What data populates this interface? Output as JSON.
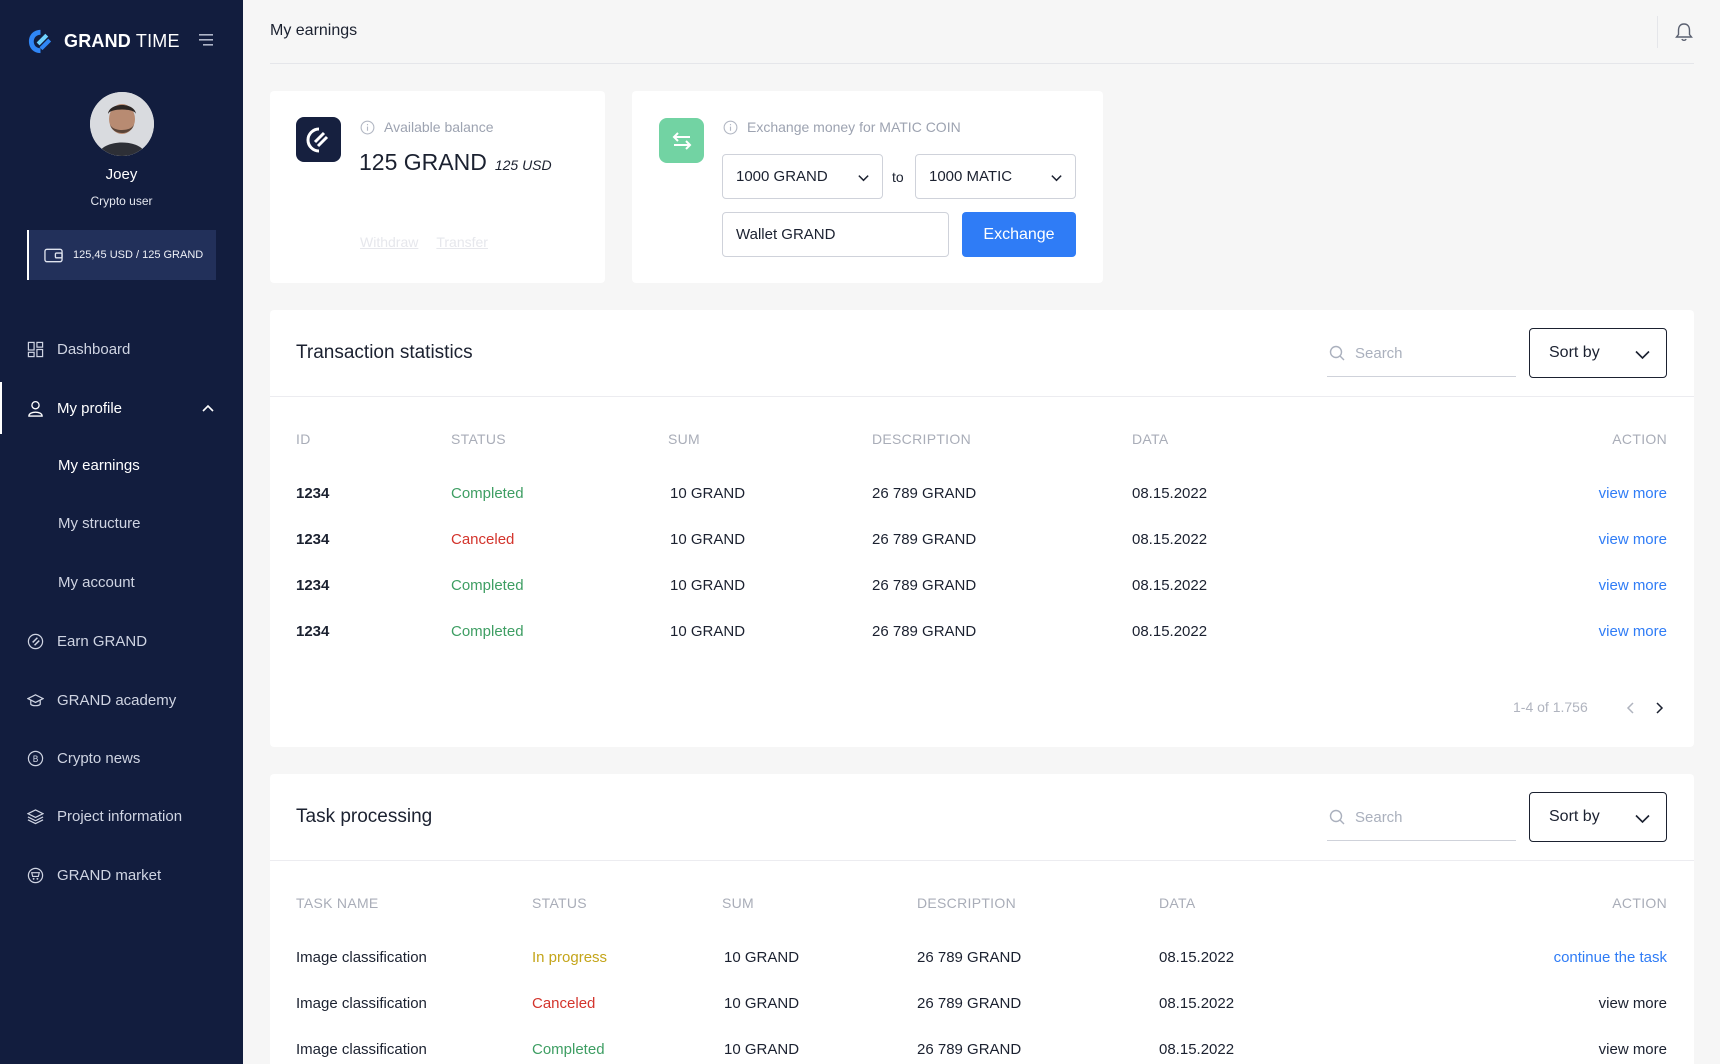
{
  "sidebar": {
    "brand": {
      "bold": "GRAND",
      "light": " TIME"
    },
    "user": {
      "name": "Joey",
      "role": "Crypto user"
    },
    "wallet": "125,45 USD / 125 GRAND",
    "nav": [
      {
        "label": "Dashboard",
        "icon": "dashboard-icon"
      },
      {
        "label": "My profile",
        "icon": "user-icon"
      },
      {
        "label": "Earn GRAND",
        "icon": "grand-coin-icon"
      },
      {
        "label": "GRAND academy",
        "icon": "graduation-cap-icon"
      },
      {
        "label": "Crypto news",
        "icon": "bitcoin-icon"
      },
      {
        "label": "Project information",
        "icon": "layers-icon"
      },
      {
        "label": "GRAND market",
        "icon": "market-coin-icon"
      }
    ],
    "profile_sub": [
      "My earnings",
      "My structure",
      "My account"
    ]
  },
  "header": {
    "title": "My earnings"
  },
  "balance": {
    "label": "Available balance",
    "value": "125 GRAND",
    "usd": "125 USD",
    "withdraw": "Withdraw",
    "transfer": "Transfer"
  },
  "exchange": {
    "label": "Exchange money for MATIC COIN",
    "from": "1000 GRAND",
    "to_word": "to",
    "to": "1000 MATIC",
    "wallet": "Wallet GRAND",
    "button": "Exchange"
  },
  "transactions": {
    "title": "Transaction statistics",
    "search_placeholder": "Search",
    "sort": "Sort by",
    "columns": [
      "ID",
      "STATUS",
      "SUM",
      "DESCRIPTION",
      "DATA",
      "ACTION"
    ],
    "rows": [
      {
        "id": "1234",
        "status": "Completed",
        "sum": "10 GRAND",
        "desc": "26 789 GRAND",
        "date": "08.15.2022",
        "action": "view more"
      },
      {
        "id": "1234",
        "status": "Canceled",
        "sum": "10 GRAND",
        "desc": "26 789 GRAND",
        "date": "08.15.2022",
        "action": "view more"
      },
      {
        "id": "1234",
        "status": "Completed",
        "sum": "10 GRAND",
        "desc": "26 789 GRAND",
        "date": "08.15.2022",
        "action": "view more"
      },
      {
        "id": "1234",
        "status": "Completed",
        "sum": "10 GRAND",
        "desc": "26 789 GRAND",
        "date": "08.15.2022",
        "action": "view more"
      }
    ],
    "pagination": "1-4 of 1.756"
  },
  "tasks": {
    "title": "Task processing",
    "search_placeholder": "Search",
    "sort": "Sort by",
    "columns": [
      "TASK NAME",
      "STATUS",
      "SUM",
      "DESCRIPTION",
      "DATA",
      "ACTION"
    ],
    "rows": [
      {
        "name": "Image classification",
        "status": "In progress",
        "sum": "10 GRAND",
        "desc": "26 789 GRAND",
        "date": "08.15.2022",
        "action": "continue the task"
      },
      {
        "name": "Image classification",
        "status": "Canceled",
        "sum": "10 GRAND",
        "desc": "26 789 GRAND",
        "date": "08.15.2022",
        "action": "view more"
      },
      {
        "name": "Image classification",
        "status": "Completed",
        "sum": "10 GRAND",
        "desc": "26 789 GRAND",
        "date": "08.15.2022",
        "action": "view more"
      }
    ]
  },
  "colors": {
    "sidebar": "#121d3e",
    "accent": "#2f7cf6",
    "completed": "#3e9e63",
    "canceled": "#d3342c",
    "in_progress": "#c4a51a",
    "exchange_tile": "#72d3a3"
  }
}
